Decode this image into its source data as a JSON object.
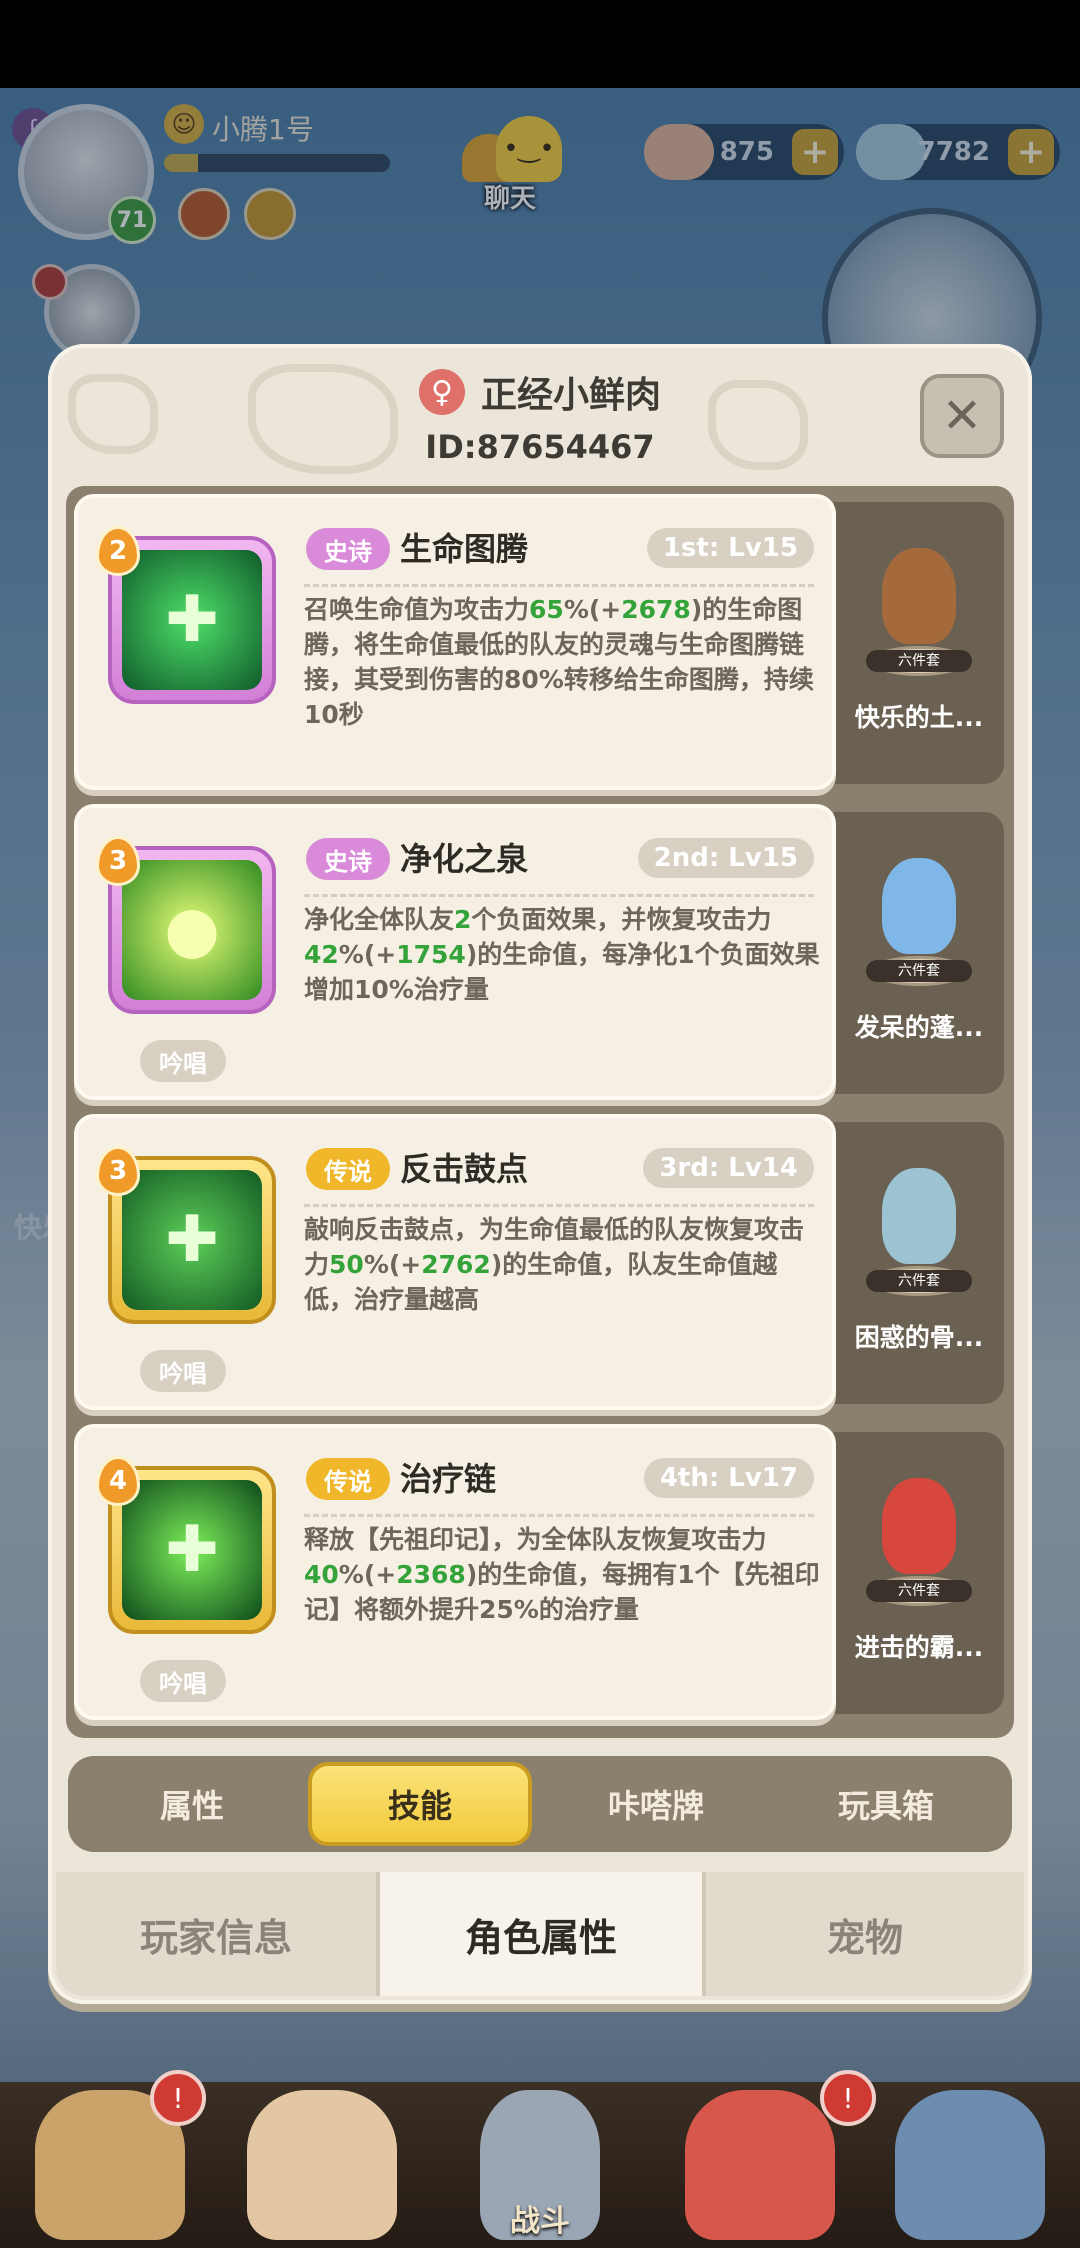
{
  "hud": {
    "player_name": "小腾1号",
    "level": "71",
    "xp_fraction": 0.15,
    "chat_label": "聊天",
    "currency_1": "875",
    "currency_2": "7782",
    "plus_label": "+",
    "left_edge_text": "快乐"
  },
  "modal": {
    "gender_icon": "♀",
    "player_name": "正经小鲜肉",
    "player_id": "ID:87654467",
    "close_label": "✕"
  },
  "skills": [
    {
      "num": "2",
      "rarity": "史诗",
      "rarity_type": "epic",
      "name": "生命图腾",
      "slot_level": "1st: Lv15",
      "desc_1": "召唤生命值为攻击力",
      "hl_1": "65",
      "desc_2": "%(+",
      "hl_2": "2678",
      "desc_3": ")的生命图腾，将生命值最低的队友的灵魂与生命图腾链接，其受到伤害的80%转移给生命图腾，持续10秒",
      "chant": "",
      "icon_glyph": "✚",
      "pet_name": "快乐的土...",
      "pet_tag": "六件套"
    },
    {
      "num": "3",
      "rarity": "史诗",
      "rarity_type": "epic",
      "name": "净化之泉",
      "slot_level": "2nd: Lv15",
      "desc_1": "净化全体队友",
      "hl_1": "2",
      "desc_2": "个负面效果，并恢复攻击力",
      "hl_2": "42",
      "desc_3": "%(+",
      "hl_3": "1754",
      "desc_4": ")的生命值，每净化1个负面效果增加10%治疗量",
      "chant": "吟唱",
      "icon_glyph": "●",
      "pet_name": "发呆的蓬...",
      "pet_tag": "六件套"
    },
    {
      "num": "3",
      "rarity": "传说",
      "rarity_type": "legend",
      "name": "反击鼓点",
      "slot_level": "3rd: Lv14",
      "desc_1": "敲响反击鼓点，为生命值最低的队友恢复攻击力",
      "hl_1": "50",
      "desc_2": "%(+",
      "hl_2": "2762",
      "desc_3": ")的生命值，队友生命值越低，治疗量越高",
      "chant": "吟唱",
      "icon_glyph": "✚",
      "pet_name": "困惑的骨...",
      "pet_tag": "六件套"
    },
    {
      "num": "4",
      "rarity": "传说",
      "rarity_type": "legend",
      "name": "治疗链",
      "slot_level": "4th: Lv17",
      "desc_1": "释放【先祖印记】，为全体队友恢复攻击力",
      "hl_1": "40",
      "desc_2": "%(+",
      "hl_2": "2368",
      "desc_3": ")的生命值，每拥有1个【先祖印记】将额外提升25%的治疗量",
      "chant": "吟唱",
      "icon_glyph": "✚",
      "pet_name": "进击的霸...",
      "pet_tag": "六件套"
    }
  ],
  "sub_tabs": [
    "属性",
    "技能",
    "咔嗒牌",
    "玩具箱"
  ],
  "main_tabs": [
    "玩家信息",
    "角色属性",
    "宠物"
  ],
  "game_nav": {
    "battle_label": "战斗",
    "bell_icon": "!"
  },
  "colors": {
    "epic": "#d98ad8",
    "legend": "#f0b72a",
    "highlight": "#33a33a",
    "active_tab": "#f1c93b"
  }
}
